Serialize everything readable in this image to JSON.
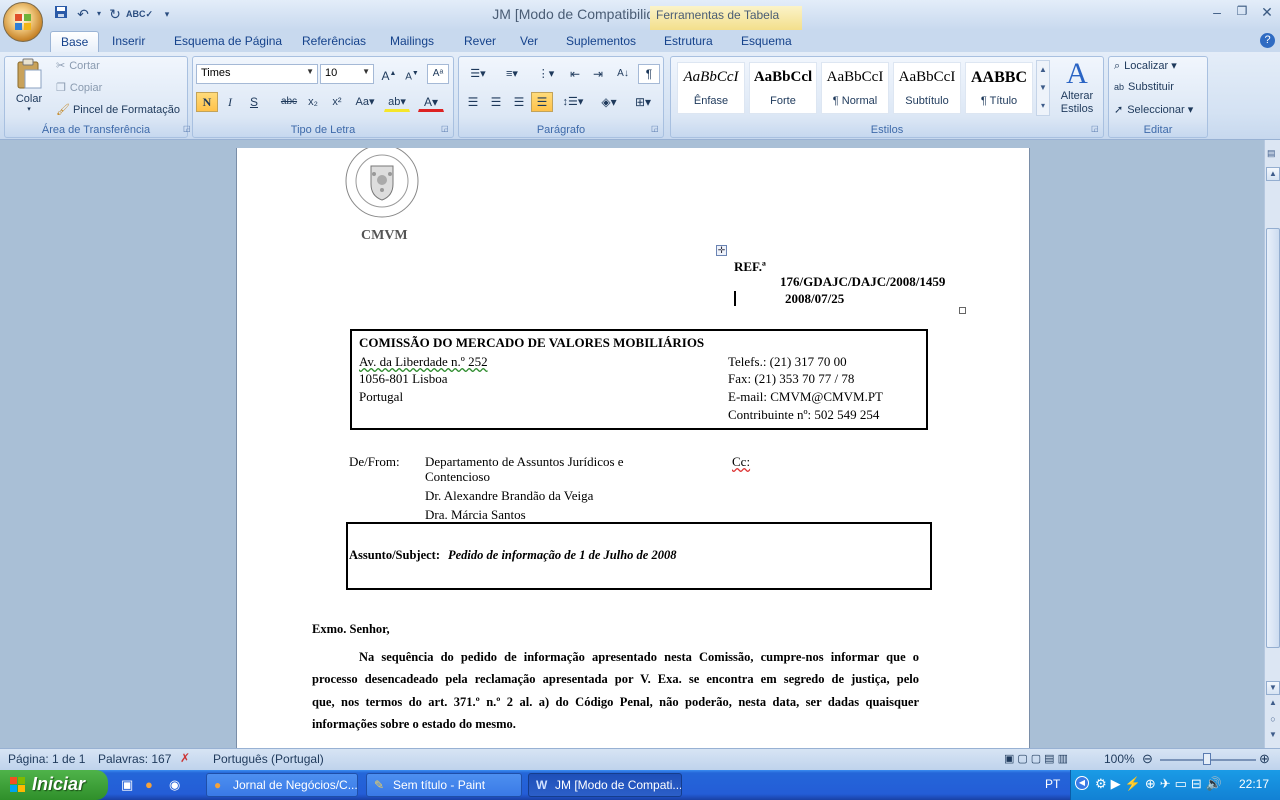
{
  "window": {
    "title": "JM [Modo de Compatibilidade] - Microsoft Word",
    "context_tab": "Ferramentas de Tabela"
  },
  "tabs": [
    "Base",
    "Inserir",
    "Esquema de Página",
    "Referências",
    "Mailings",
    "Rever",
    "Ver",
    "Suplementos",
    "Estrutura",
    "Esquema"
  ],
  "ribbon": {
    "clipboard": {
      "label": "Área de Transferência",
      "paste": "Colar",
      "cut": "Cortar",
      "copy": "Copiar",
      "format_painter": "Pincel de Formatação"
    },
    "font": {
      "label": "Tipo de Letra",
      "family": "Times",
      "size": "10"
    },
    "paragraph": {
      "label": "Parágrafo"
    },
    "styles": {
      "label": "Estilos",
      "change_styles": "Alterar Estilos",
      "items": [
        {
          "preview": "AaBbCcI",
          "name": "Ênfase"
        },
        {
          "preview": "AaBbCcl",
          "name": "Forte"
        },
        {
          "preview": "AaBbCcI",
          "name": "¶ Normal"
        },
        {
          "preview": "AaBbCcI",
          "name": "Subtítulo"
        },
        {
          "preview": "AABBC",
          "name": "¶ Título"
        }
      ]
    },
    "editing": {
      "label": "Editar",
      "find": "Localizar",
      "replace": "Substituir",
      "select": "Seleccionar"
    }
  },
  "document": {
    "logo_text": "CMVM",
    "ref_label": "REF.ª",
    "ref_number": "176/GDAJC/DAJC/2008/1459",
    "date": "2008/07/25",
    "header_box": {
      "name": "COMISSÃO  DO MERCADO  DE VALORES MOBILIÁRIOS",
      "address1": "Av. da Liberdade n.º 252",
      "address2": "1056-801 Lisboa",
      "country": "Portugal",
      "phone": "Telefs.: (21) 317 70 00",
      "fax": "Fax:    (21) 353 70 77 / 78",
      "email": "E-mail: CMVM@CMVM.PT",
      "taxid": "Contribuinte nº: 502 549 254"
    },
    "from_label": "De/From:",
    "from_lines": [
      "Departamento de Assuntos Jurídicos e",
      "Contencioso",
      "Dr. Alexandre Brandão da Veiga",
      "Dra. Márcia Santos"
    ],
    "cc_label": "Cc:",
    "subject_label": "Assunto/Subject:",
    "subject": "Pedido de informação de 1 de Julho de 2008",
    "salutation": "Exmo. Senhor,",
    "body_lines": [
      "Na sequência do pedido de informação apresentado nesta Comissão, cumpre-nos informar que o",
      "processo desencadeado pela reclamação apresentada por V. Exa. se encontra em segredo de justiça, pelo",
      "que, nos termos do art. 371.º n.º 2 al. a) do Código Penal, não poderão, nesta data, ser dadas quaisquer",
      "informações sobre o estado do mesmo."
    ]
  },
  "status": {
    "page": "Página: 1 de 1",
    "words": "Palavras: 167",
    "language": "Português (Portugal)",
    "zoom": "100%"
  },
  "taskbar": {
    "start": "Iniciar",
    "tasks": [
      "Jornal de Negócios/C...",
      "Sem título - Paint",
      "JM [Modo de Compati..."
    ],
    "lang": "PT",
    "clock": "22:17"
  }
}
